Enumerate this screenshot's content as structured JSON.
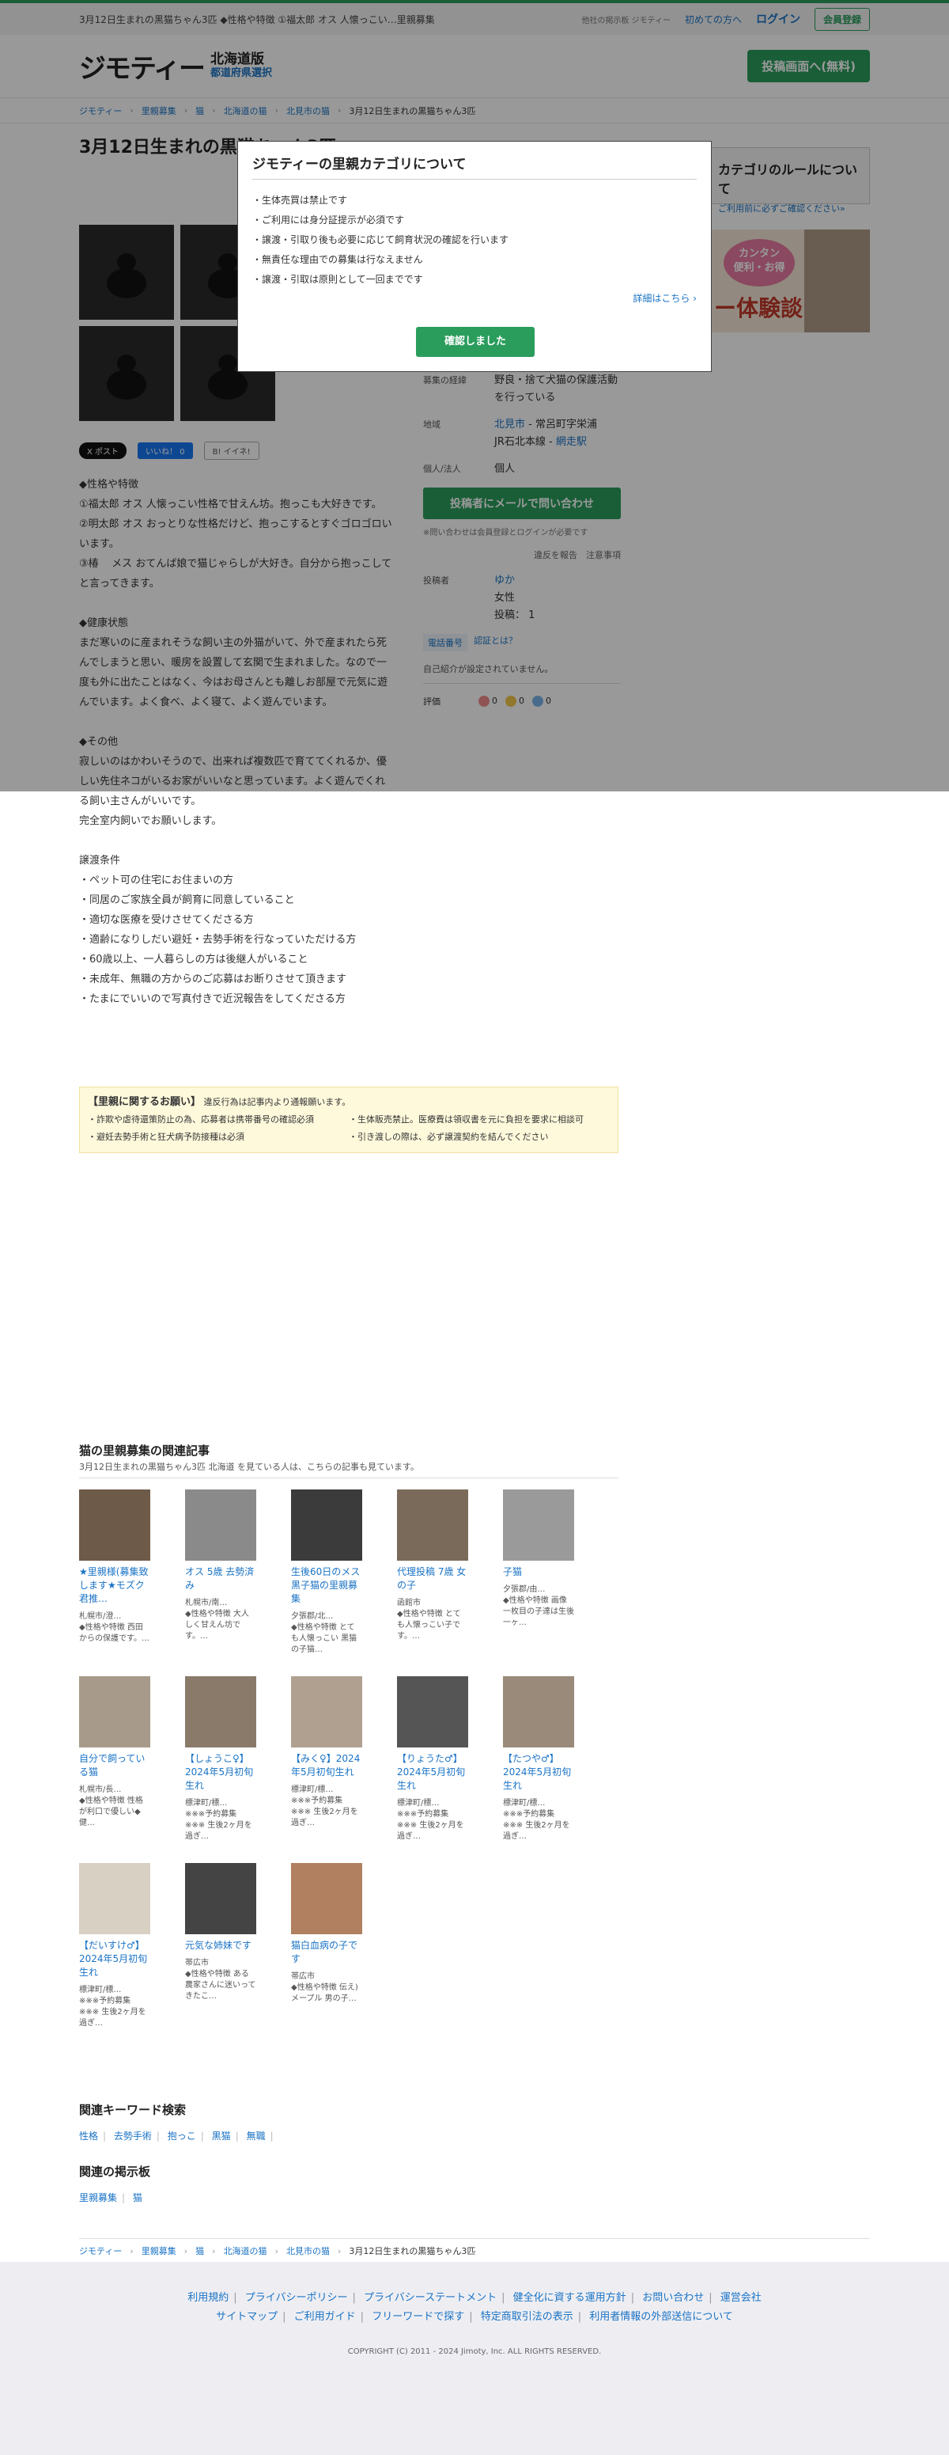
{
  "topbar": {
    "lead": "3月12日生まれの黒猫ちゃん3匹 ◆性格や特徴 ①福太郎 オス 人懐っこい…里親募集",
    "other_sites": "他社の掲示板 ジモティー",
    "beginner": "初めての方へ",
    "login": "ログイン",
    "register": "会員登録"
  },
  "header": {
    "logo": "ジモティー",
    "pref": "北海道版",
    "select": "都道府県選択",
    "post": "投稿画面へ(無料)"
  },
  "breadcrumb": [
    "ジモティー",
    "里親募集",
    "猫",
    "北海道の猫",
    "北見市の猫",
    "3月12日生まれの黒猫ちゃん3匹"
  ],
  "title": "3月12日生まれの黒猫ちゃん3匹",
  "rules": {
    "title": "カテゴリのルールについて",
    "sub": "ご利用前に必ずご確認ください»"
  },
  "banner": {
    "bubble1": "カンタン",
    "bubble2": "便利・お得",
    "big": "ー体験談"
  },
  "share": {
    "x": "X ポスト",
    "fb": "いいね！ 0",
    "hb": "B! イイネ!"
  },
  "description": "◆性格や特徴\n①福太郎 オス 人懐っこい性格で甘えん坊。抱っこも大好きです。\n②明太郎 オス おっとりな性格だけど、抱っこするとすぐゴロゴロいいます。\n③椿    メス おてんば娘で猫じゃらしが大好き。自分から抱っこしてと言ってきます。\n\n◆健康状態\nまだ寒いのに産まれそうな飼い主の外猫がいて、外で産まれたら死んでしまうと思い、暖房を設置して玄関で生まれました。なので一度も外に出たことはなく、今はお母さんとも離しお部屋で元気に遊んでいます。よく食べ、よく寝て、よく遊んでいます。\n\n◆その他\n寂しいのはかわいそうので、出来れば複数匹で育ててくれるか、優しい先住ネコがいるお家がいいなと思っています。よく遊んでくれる飼い主さんがいいです。\n完全室内飼いでお願いします。\n\n譲渡条件\n・ペット可の住宅にお住まいの方\n・同居のご家族全員が飼育に同意していること\n・適切な医療を受けさせてくださる方\n・適齢になりしだい避妊・去勢手術を行なっていただける方\n・60歳以上、一人暮らしの方は後継人がいること\n・未成年、無職の方からのご応募はお断りさせて頂きます\n・たまにでいいので写真付きで近況報告をしてくださる方",
  "side": {
    "reason_k": "募集の経緯",
    "reason_v": "野良・捨て犬猫の保護活動を行っている",
    "area_k": "地域",
    "area_city": "北見市",
    "area_rest": " - 常呂町字栄浦",
    "area_line": "JR石北本線 - ",
    "area_station": "網走駅",
    "type_k": "個人/法人",
    "type_v": "個人",
    "mail": "投稿者にメールで問い合わせ",
    "mail_note": "※問い合わせは会員登録とログインが必要です",
    "report": "違反を報告",
    "caution": "注意事項",
    "poster_k": "投稿者",
    "poster_name": "ゆか",
    "poster_sex": "女性",
    "poster_count": "投稿： 1",
    "verify1": "電話番号",
    "verify2": "認証とは？",
    "intro": "自己紹介が設定されていません。",
    "eval_k": "評価",
    "eval_good": "0",
    "eval_mid": "0",
    "eval_bad": "0"
  },
  "modal": {
    "title": "ジモティーの里親カテゴリについて",
    "items": [
      "・生体売買は禁止です",
      "・ご利用には身分証提示が必須です",
      "・譲渡・引取り後も必要に応じて飼育状況の確認を行います",
      "・無責任な理由での募集は行なえません",
      "・譲渡・引取は原則として一回までです"
    ],
    "more": "詳細はこちら ›",
    "ok": "確認しました"
  },
  "notice": {
    "head": "【里親に関するお願い】",
    "head_sub": "違反行為は記事内より通報願います。",
    "l1": "・詐欺や虐待還策防止の為、応募者は携帯番号の確認必須",
    "l2": "・避妊去勢手術と狂犬病予防接種は必須",
    "r1": "・生体販売禁止。医療費は領収書を元に負担を要求に相談可",
    "r2": "・引き渡しの際は、必ず譲渡契約を結んでください"
  },
  "related": {
    "title": "猫の里親募集の関連記事",
    "sub": "3月12日生まれの黒猫ちゃん3匹 北海道 を見ている人は、こちらの記事も見ています。",
    "cards": [
      {
        "t": "★里親様(募集致します★モズク君推…",
        "loc": "札幌市/澄…",
        "d": "◆性格や特徴 西田からの保護です。…"
      },
      {
        "t": "オス 5歳 去勢済み",
        "loc": "札幌市/南…",
        "d": "◆性格や特徴 大人しく甘えん坊です。…"
      },
      {
        "t": "生後60日のメス黒子猫の里親募集",
        "loc": "夕張郡/北…",
        "d": "◆性格や特徴 とても人懐っこい 黒猫の子猫…"
      },
      {
        "t": "代理投稿 7歳 女の子",
        "loc": "函館市",
        "d": "◆性格や特徴 とても人懐っこい子です。…"
      },
      {
        "t": "子猫",
        "loc": "夕張郡/由…",
        "d": "◆性格や特徴 画像一枚目の子達は生後一ヶ…"
      },
      {
        "t": "自分で飼っている猫",
        "loc": "札幌市/長…",
        "d": "◆性格や特徴 性格が利口で優しい◆健…"
      },
      {
        "t": "【しょうこ♀】2024年5月初旬生れ",
        "loc": "標津町/標…",
        "d": "※※※予約募集 ※※※ 生後2ヶ月を過ぎ…"
      },
      {
        "t": "【みく♀】2024年5月初旬生れ",
        "loc": "標津町/標…",
        "d": "※※※予約募集 ※※※ 生後2ヶ月を過ぎ…"
      },
      {
        "t": "【りょうた♂】2024年5月初旬生れ",
        "loc": "標津町/標…",
        "d": "※※※予約募集 ※※※ 生後2ヶ月を過ぎ…"
      },
      {
        "t": "【たつや♂】2024年5月初旬生れ",
        "loc": "標津町/標…",
        "d": "※※※予約募集 ※※※ 生後2ヶ月を過ぎ…"
      },
      {
        "t": "【だいすけ♂】2024年5月初旬生れ",
        "loc": "標津町/標…",
        "d": "※※※予約募集 ※※※ 生後2ヶ月を過ぎ…"
      },
      {
        "t": "元気な姉妹です",
        "loc": "帯広市",
        "d": "◆性格や特徴 ある農家さんに迷いってきたこ…"
      },
      {
        "t": "猫白血病の子です",
        "loc": "帯広市",
        "d": "◆性格や特徴 伝え) メープル 男の子…"
      }
    ]
  },
  "keywords": {
    "title": "関連キーワード検索",
    "items": [
      "性格",
      "去勢手術",
      "抱っこ",
      "黒猫",
      "無職"
    ]
  },
  "boards": {
    "title": "関連の掲示板",
    "items": [
      "里親募集",
      "猫"
    ]
  },
  "footer": {
    "row1": [
      "利用規約",
      "プライバシーポリシー",
      "プライバシーステートメント",
      "健全化に資する運用方針",
      "お問い合わせ",
      "運営会社"
    ],
    "row2": [
      "サイトマップ",
      "ご利用ガイド",
      "フリーワードで探す",
      "特定商取引法の表示",
      "利用者情報の外部送信について"
    ],
    "copy": "COPYRIGHT (C) 2011 - 2024 Jimoty, Inc. ALL RIGHTS RESERVED."
  }
}
